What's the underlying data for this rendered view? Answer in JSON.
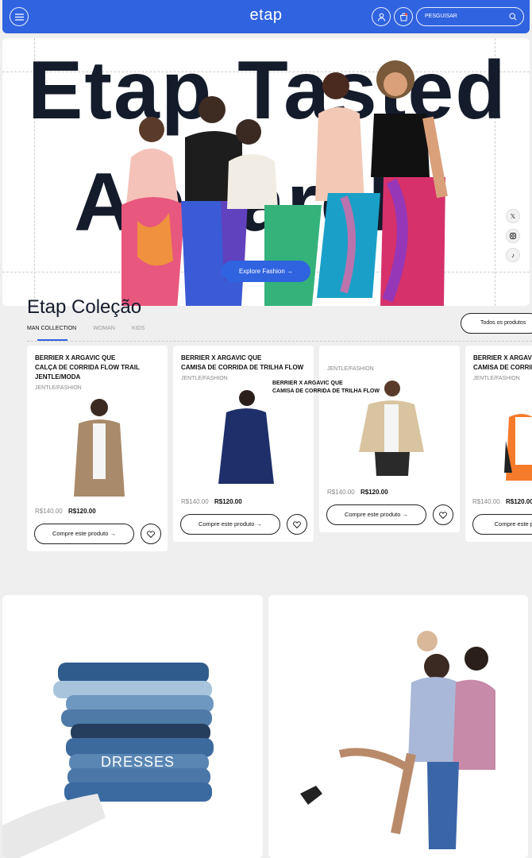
{
  "header": {
    "logo": "etap",
    "search_placeholder": "PESGUISAR",
    "menu_icon": "hamburger-menu-icon",
    "user_icon": "user-icon",
    "cart_icon": "shopping-bag-icon",
    "search_icon": "search-icon"
  },
  "hero": {
    "title_line1": "Etap Tasted",
    "title_line2": "Apparel",
    "explore_label": "Explore Fashion",
    "social": [
      "x-icon",
      "instagram-icon",
      "tiktok-icon"
    ]
  },
  "collection": {
    "title": "Etap Coleção",
    "tabs": [
      {
        "label": "MAN COLLECTION",
        "active": true
      },
      {
        "label": "WOMAN",
        "active": false
      },
      {
        "label": "KIDS",
        "active": false
      }
    ],
    "all_products_label": "Todos os produtos",
    "cards": [
      {
        "title_line1": "BERRIER X ARGAVIC QUE",
        "title_line2": "CALÇA DE CORRIDA FLOW TRAIL",
        "title_line3": "JENTLE/MODA",
        "brand": "JENTLE/FASHION",
        "price_old": "R$140.00",
        "price_new": "R$120.00",
        "buy_label": "Compre este produto"
      },
      {
        "title_line1": "BERRIER X ARGAVIC QUE",
        "title_line2": "CAMISA DE CORRIDA DE TRILHA FLOW",
        "brand": "JENTLE/FASHION",
        "price_old": "R$140.00",
        "price_new": "R$120.00",
        "buy_label": "Compre este produto"
      },
      {
        "title_line1": "BERRIER X ARGAVIC QUE",
        "title_line2": "CAMISA DE CORRIDA DE TRILHA FLOW",
        "brand": "JENTLE/FASHION",
        "price_old": "R$140.00",
        "price_new": "R$120.00",
        "buy_label": "Compre este produto"
      },
      {
        "title_line1": "BERRIER X ARGAVIC QUE",
        "title_line2": "CAMISA DE CORRIDA DE TRILHA FLOW",
        "brand": "JENTLE/FASHION",
        "price_old": "R$140.00",
        "price_new": "R$120.00",
        "buy_label": "Compre este produto"
      }
    ]
  },
  "categories": {
    "left_label": "DRESSES"
  },
  "colors": {
    "accent": "#2f63e0",
    "text_dark": "#141b2b",
    "background": "#efefef"
  }
}
